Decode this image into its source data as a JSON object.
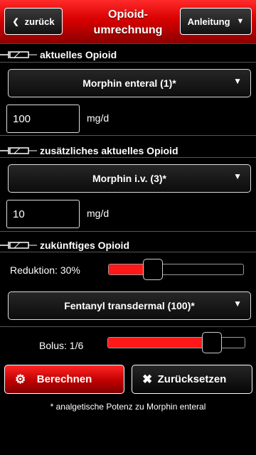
{
  "header": {
    "back_label": "zurück",
    "title": "Opioid-umrechnung",
    "guide_label": "Anleitung"
  },
  "current": {
    "heading": "aktuelles Opioid",
    "select_value": "Morphin enteral (1)*",
    "dose_value": "100",
    "unit": "mg/d"
  },
  "additional": {
    "heading": "zusätzliches aktuelles Opioid",
    "select_value": "Morphin i.v. (3)*",
    "dose_value": "10",
    "unit": "mg/d"
  },
  "future": {
    "heading": "zukünftiges Opioid",
    "reduction_label": "Reduktion: 30%",
    "reduction_level": 0.3,
    "select_value": "Fentanyl transdermal (100)*"
  },
  "bolus": {
    "label": "Bolus: 1/6",
    "level": 0.8
  },
  "actions": {
    "calculate_label": "Berechnen",
    "reset_label": "Zurücksetzen"
  },
  "footnote": "* analgetische Potenz zu Morphin enteral",
  "colors": {
    "accent": "#ff1818",
    "background": "#000000"
  },
  "icons": [
    "chevron-left-icon",
    "chevron-down-icon",
    "syringe-icon",
    "gear-icon",
    "close-icon"
  ]
}
